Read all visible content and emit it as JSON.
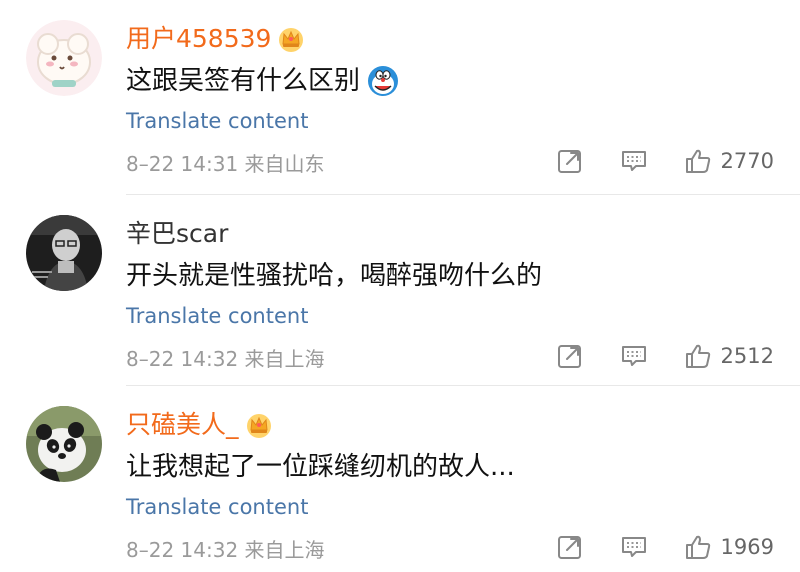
{
  "comments": [
    {
      "username": "用户458539",
      "vip": true,
      "text": "这跟吴签有什么区别",
      "translate_label": "Translate content",
      "time": "8–22 14:31",
      "location": "来自山东",
      "likes": "2770"
    },
    {
      "username": "辛巴scar",
      "vip": false,
      "text": "开头就是性骚扰哈，喝醉强吻什么的",
      "translate_label": "Translate content",
      "time": "8–22 14:32",
      "location": "来自上海",
      "likes": "2512"
    },
    {
      "username": "只磕美人_",
      "vip": true,
      "text": "让我想起了一位踩缝纫机的故人...",
      "translate_label": "Translate content",
      "time": "8–22 14:32",
      "location": "来自上海",
      "likes": "1969"
    }
  ],
  "colors": {
    "vip_name": "#f26a1b",
    "link": "#4a76a8",
    "meta": "#9a9a9a"
  },
  "icons": [
    "crown-badge-icon",
    "doraemon-emoji-icon",
    "share-icon",
    "comment-icon",
    "thumbs-up-icon"
  ]
}
